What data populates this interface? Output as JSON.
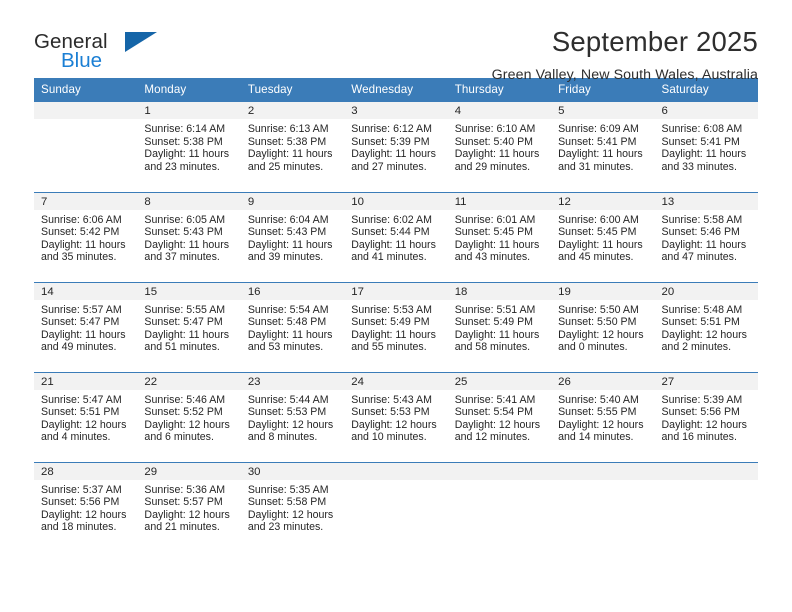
{
  "brand": {
    "name_part1": "General",
    "name_part2": "Blue",
    "triangle_icon": "triangle-icon",
    "accent_color": "#1b7fd4",
    "triangle_color": "#1565a8"
  },
  "header": {
    "month_title": "September 2025",
    "location": "Green Valley, New South Wales, Australia"
  },
  "calendar": {
    "header_bg": "#3b7cb8",
    "header_text_color": "#ffffff",
    "daynum_band_bg": "#f2f2f2",
    "weekday_headers": [
      "Sunday",
      "Monday",
      "Tuesday",
      "Wednesday",
      "Thursday",
      "Friday",
      "Saturday"
    ],
    "labels": {
      "sunrise": "Sunrise:",
      "sunset": "Sunset:",
      "daylight": "Daylight:"
    },
    "weeks": [
      [
        {
          "day": "",
          "sunrise": "",
          "sunset": "",
          "daylight_line1": "",
          "daylight_line2": ""
        },
        {
          "day": "1",
          "sunrise": "Sunrise: 6:14 AM",
          "sunset": "Sunset: 5:38 PM",
          "daylight_line1": "Daylight: 11 hours",
          "daylight_line2": "and 23 minutes."
        },
        {
          "day": "2",
          "sunrise": "Sunrise: 6:13 AM",
          "sunset": "Sunset: 5:38 PM",
          "daylight_line1": "Daylight: 11 hours",
          "daylight_line2": "and 25 minutes."
        },
        {
          "day": "3",
          "sunrise": "Sunrise: 6:12 AM",
          "sunset": "Sunset: 5:39 PM",
          "daylight_line1": "Daylight: 11 hours",
          "daylight_line2": "and 27 minutes."
        },
        {
          "day": "4",
          "sunrise": "Sunrise: 6:10 AM",
          "sunset": "Sunset: 5:40 PM",
          "daylight_line1": "Daylight: 11 hours",
          "daylight_line2": "and 29 minutes."
        },
        {
          "day": "5",
          "sunrise": "Sunrise: 6:09 AM",
          "sunset": "Sunset: 5:41 PM",
          "daylight_line1": "Daylight: 11 hours",
          "daylight_line2": "and 31 minutes."
        },
        {
          "day": "6",
          "sunrise": "Sunrise: 6:08 AM",
          "sunset": "Sunset: 5:41 PM",
          "daylight_line1": "Daylight: 11 hours",
          "daylight_line2": "and 33 minutes."
        }
      ],
      [
        {
          "day": "7",
          "sunrise": "Sunrise: 6:06 AM",
          "sunset": "Sunset: 5:42 PM",
          "daylight_line1": "Daylight: 11 hours",
          "daylight_line2": "and 35 minutes."
        },
        {
          "day": "8",
          "sunrise": "Sunrise: 6:05 AM",
          "sunset": "Sunset: 5:43 PM",
          "daylight_line1": "Daylight: 11 hours",
          "daylight_line2": "and 37 minutes."
        },
        {
          "day": "9",
          "sunrise": "Sunrise: 6:04 AM",
          "sunset": "Sunset: 5:43 PM",
          "daylight_line1": "Daylight: 11 hours",
          "daylight_line2": "and 39 minutes."
        },
        {
          "day": "10",
          "sunrise": "Sunrise: 6:02 AM",
          "sunset": "Sunset: 5:44 PM",
          "daylight_line1": "Daylight: 11 hours",
          "daylight_line2": "and 41 minutes."
        },
        {
          "day": "11",
          "sunrise": "Sunrise: 6:01 AM",
          "sunset": "Sunset: 5:45 PM",
          "daylight_line1": "Daylight: 11 hours",
          "daylight_line2": "and 43 minutes."
        },
        {
          "day": "12",
          "sunrise": "Sunrise: 6:00 AM",
          "sunset": "Sunset: 5:45 PM",
          "daylight_line1": "Daylight: 11 hours",
          "daylight_line2": "and 45 minutes."
        },
        {
          "day": "13",
          "sunrise": "Sunrise: 5:58 AM",
          "sunset": "Sunset: 5:46 PM",
          "daylight_line1": "Daylight: 11 hours",
          "daylight_line2": "and 47 minutes."
        }
      ],
      [
        {
          "day": "14",
          "sunrise": "Sunrise: 5:57 AM",
          "sunset": "Sunset: 5:47 PM",
          "daylight_line1": "Daylight: 11 hours",
          "daylight_line2": "and 49 minutes."
        },
        {
          "day": "15",
          "sunrise": "Sunrise: 5:55 AM",
          "sunset": "Sunset: 5:47 PM",
          "daylight_line1": "Daylight: 11 hours",
          "daylight_line2": "and 51 minutes."
        },
        {
          "day": "16",
          "sunrise": "Sunrise: 5:54 AM",
          "sunset": "Sunset: 5:48 PM",
          "daylight_line1": "Daylight: 11 hours",
          "daylight_line2": "and 53 minutes."
        },
        {
          "day": "17",
          "sunrise": "Sunrise: 5:53 AM",
          "sunset": "Sunset: 5:49 PM",
          "daylight_line1": "Daylight: 11 hours",
          "daylight_line2": "and 55 minutes."
        },
        {
          "day": "18",
          "sunrise": "Sunrise: 5:51 AM",
          "sunset": "Sunset: 5:49 PM",
          "daylight_line1": "Daylight: 11 hours",
          "daylight_line2": "and 58 minutes."
        },
        {
          "day": "19",
          "sunrise": "Sunrise: 5:50 AM",
          "sunset": "Sunset: 5:50 PM",
          "daylight_line1": "Daylight: 12 hours",
          "daylight_line2": "and 0 minutes."
        },
        {
          "day": "20",
          "sunrise": "Sunrise: 5:48 AM",
          "sunset": "Sunset: 5:51 PM",
          "daylight_line1": "Daylight: 12 hours",
          "daylight_line2": "and 2 minutes."
        }
      ],
      [
        {
          "day": "21",
          "sunrise": "Sunrise: 5:47 AM",
          "sunset": "Sunset: 5:51 PM",
          "daylight_line1": "Daylight: 12 hours",
          "daylight_line2": "and 4 minutes."
        },
        {
          "day": "22",
          "sunrise": "Sunrise: 5:46 AM",
          "sunset": "Sunset: 5:52 PM",
          "daylight_line1": "Daylight: 12 hours",
          "daylight_line2": "and 6 minutes."
        },
        {
          "day": "23",
          "sunrise": "Sunrise: 5:44 AM",
          "sunset": "Sunset: 5:53 PM",
          "daylight_line1": "Daylight: 12 hours",
          "daylight_line2": "and 8 minutes."
        },
        {
          "day": "24",
          "sunrise": "Sunrise: 5:43 AM",
          "sunset": "Sunset: 5:53 PM",
          "daylight_line1": "Daylight: 12 hours",
          "daylight_line2": "and 10 minutes."
        },
        {
          "day": "25",
          "sunrise": "Sunrise: 5:41 AM",
          "sunset": "Sunset: 5:54 PM",
          "daylight_line1": "Daylight: 12 hours",
          "daylight_line2": "and 12 minutes."
        },
        {
          "day": "26",
          "sunrise": "Sunrise: 5:40 AM",
          "sunset": "Sunset: 5:55 PM",
          "daylight_line1": "Daylight: 12 hours",
          "daylight_line2": "and 14 minutes."
        },
        {
          "day": "27",
          "sunrise": "Sunrise: 5:39 AM",
          "sunset": "Sunset: 5:56 PM",
          "daylight_line1": "Daylight: 12 hours",
          "daylight_line2": "and 16 minutes."
        }
      ],
      [
        {
          "day": "28",
          "sunrise": "Sunrise: 5:37 AM",
          "sunset": "Sunset: 5:56 PM",
          "daylight_line1": "Daylight: 12 hours",
          "daylight_line2": "and 18 minutes."
        },
        {
          "day": "29",
          "sunrise": "Sunrise: 5:36 AM",
          "sunset": "Sunset: 5:57 PM",
          "daylight_line1": "Daylight: 12 hours",
          "daylight_line2": "and 21 minutes."
        },
        {
          "day": "30",
          "sunrise": "Sunrise: 5:35 AM",
          "sunset": "Sunset: 5:58 PM",
          "daylight_line1": "Daylight: 12 hours",
          "daylight_line2": "and 23 minutes."
        },
        {
          "day": "",
          "sunrise": "",
          "sunset": "",
          "daylight_line1": "",
          "daylight_line2": ""
        },
        {
          "day": "",
          "sunrise": "",
          "sunset": "",
          "daylight_line1": "",
          "daylight_line2": ""
        },
        {
          "day": "",
          "sunrise": "",
          "sunset": "",
          "daylight_line1": "",
          "daylight_line2": ""
        },
        {
          "day": "",
          "sunrise": "",
          "sunset": "",
          "daylight_line1": "",
          "daylight_line2": ""
        }
      ]
    ]
  }
}
